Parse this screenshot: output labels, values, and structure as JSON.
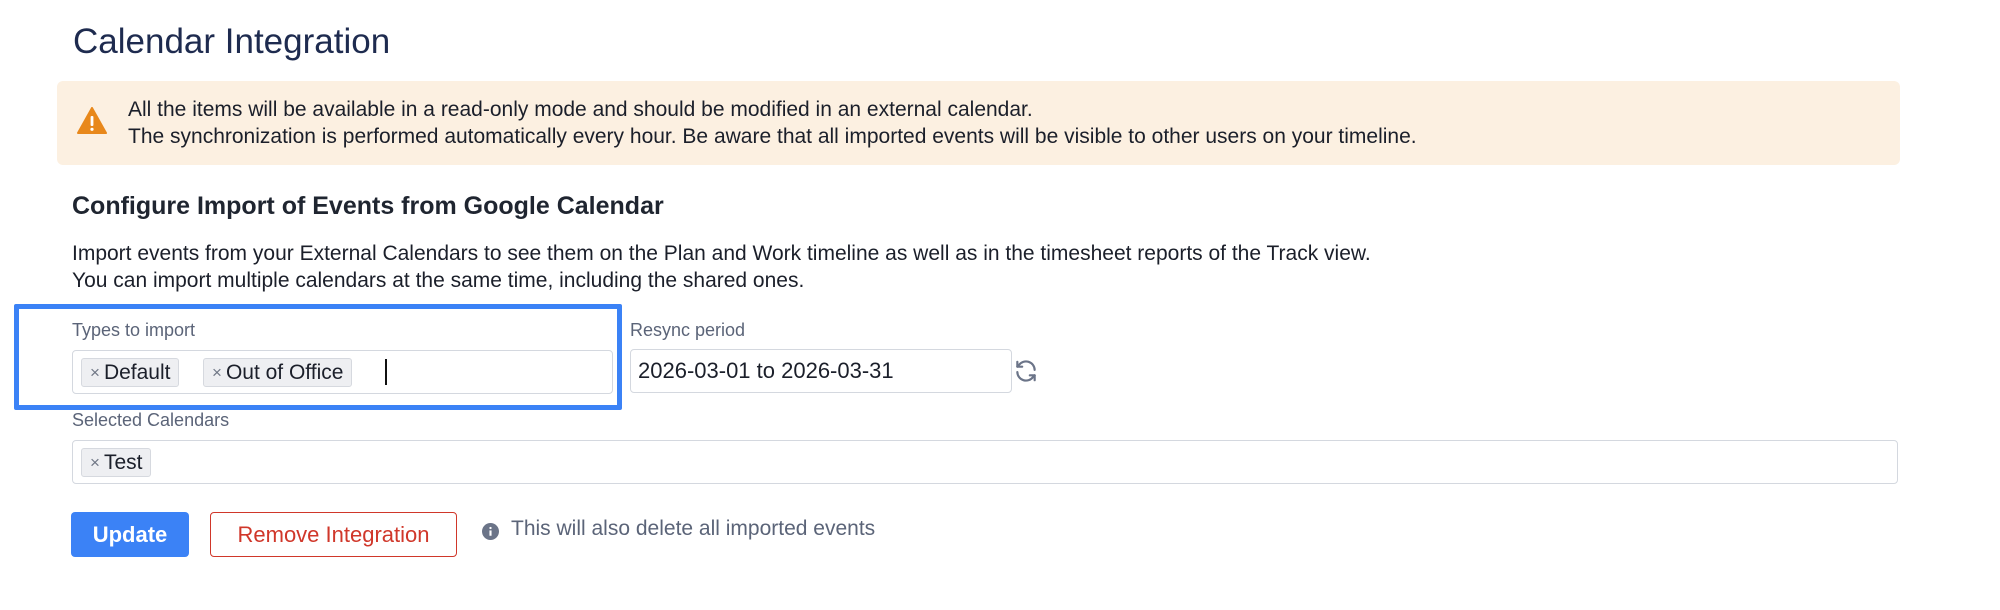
{
  "page": {
    "title": "Calendar Integration"
  },
  "alert": {
    "icon": "warning-icon",
    "color": "#e8881b",
    "background": "#fcf0e1",
    "line1": "All the items will be available in a read-only mode and should be modified in an external calendar.",
    "line2": "The synchronization is performed automatically every hour. Be aware that all imported events will be visible to other users on your timeline."
  },
  "section": {
    "title": "Configure Import of Events from Google Calendar",
    "desc_line1": "Import events from your External Calendars to see them on the Plan and Work timeline as well as in the timesheet reports of the Track view.",
    "desc_line2": "You can import multiple calendars at the same time, including the shared ones."
  },
  "types_field": {
    "label": "Types to import",
    "chips": [
      {
        "remove": "×",
        "label": "Default"
      },
      {
        "remove": "×",
        "label": "Out of Office"
      }
    ]
  },
  "resync_field": {
    "label": "Resync period",
    "value": "2026-03-01 to 2026-03-31",
    "icon": "refresh-icon"
  },
  "calendars_field": {
    "label": "Selected Calendars",
    "chips": [
      {
        "remove": "×",
        "label": "Test"
      }
    ]
  },
  "actions": {
    "update_label": "Update",
    "remove_label": "Remove Integration",
    "info_icon": "info-icon",
    "info_text": "This will also delete all imported events"
  },
  "colors": {
    "accent": "#3b82f6",
    "danger": "#d0372a",
    "focus_ring": "#3b82f6"
  }
}
